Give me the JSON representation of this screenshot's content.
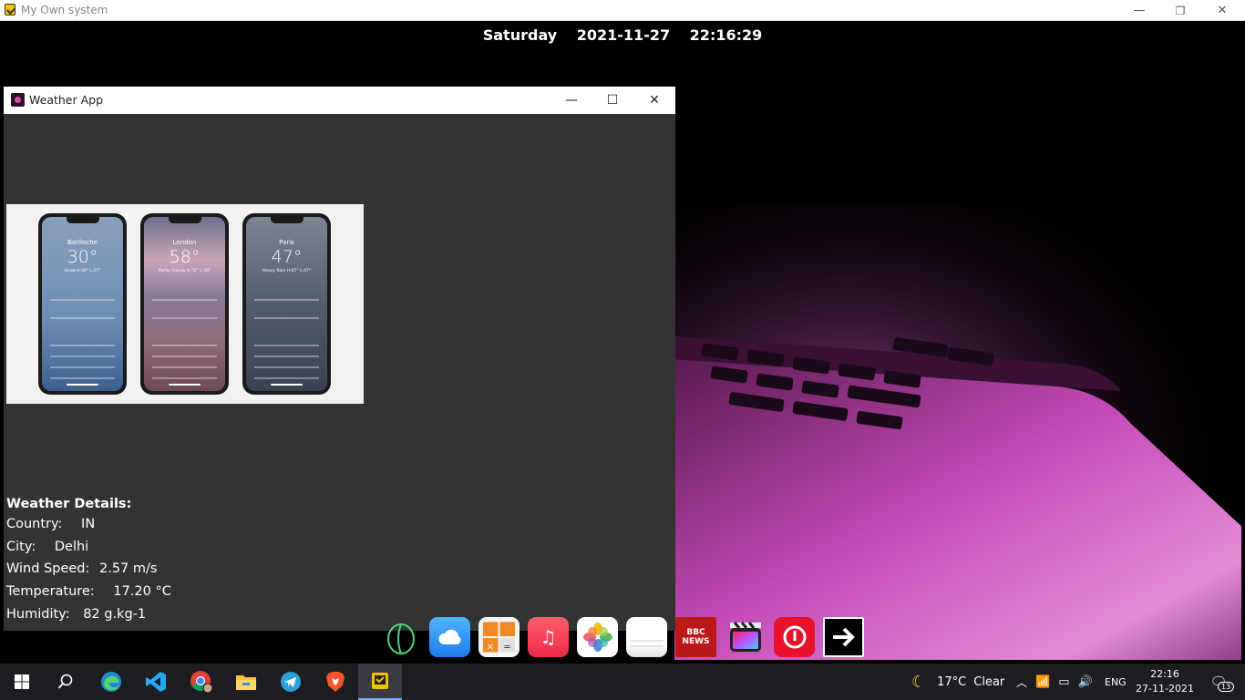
{
  "outer_window": {
    "title": "My Own system",
    "controls": {
      "minimize": "—",
      "restore": "❐",
      "close": "✕"
    }
  },
  "clock": {
    "day": "Saturday",
    "date": "2021-11-27",
    "time": "22:16:29"
  },
  "weather_window": {
    "title": "Weather App",
    "controls": {
      "minimize": "—",
      "maximize": "☐",
      "close": "✕"
    },
    "preview_phones": [
      {
        "city": "Bariloche",
        "temp": "30°",
        "cond": "Snow H:36° L:27°"
      },
      {
        "city": "London",
        "temp": "58°",
        "cond": "Partly Cloudy H:72° L:58°"
      },
      {
        "city": "Paris",
        "temp": "47°",
        "cond": "Heavy Rain H:67° L:47°"
      }
    ],
    "details": {
      "heading": "Weather Details:",
      "rows": [
        {
          "label": "Country:",
          "value": "IN"
        },
        {
          "label": "City:",
          "value": "Delhi"
        },
        {
          "label": "Wind Speed:",
          "value": "2.57 m/s"
        },
        {
          "label": "Temperature:",
          "value": "17.20 °C"
        },
        {
          "label": "Humidity:",
          "value": "82 g.kg-1"
        }
      ]
    }
  },
  "dock": {
    "bbc_label": "BBC\nNEWS"
  },
  "taskbar": {
    "weather": {
      "temp": "17°C",
      "condition": "Clear"
    },
    "language": "ENG",
    "time": "22:16",
    "date": "27-11-2021",
    "notification_count": "13"
  },
  "colors": {
    "window_bg": "#333333",
    "taskbar_bg": "#1e1e22",
    "wallpaper_accent": "#c23fb0"
  }
}
